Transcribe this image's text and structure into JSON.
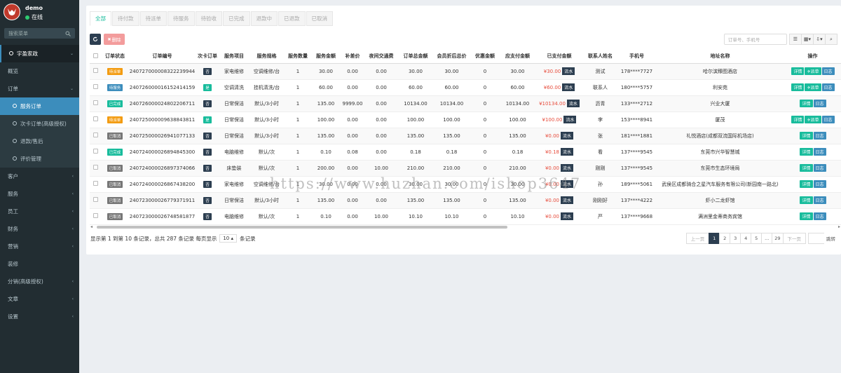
{
  "sidebar": {
    "user": "demo",
    "status": "在线",
    "search_placeholder": "搜索菜单",
    "menu": [
      {
        "label": "宇盈家政",
        "type": "hd"
      },
      {
        "label": "概览",
        "type": "normal"
      },
      {
        "label": "订单",
        "type": "normal",
        "open": true
      },
      {
        "label": "服务订单",
        "type": "act"
      },
      {
        "label": "次卡订单(高级授权)",
        "type": "sub"
      },
      {
        "label": "退款/售后",
        "type": "sub"
      },
      {
        "label": "评价管理",
        "type": "sub"
      },
      {
        "label": "客户",
        "type": "normal"
      },
      {
        "label": "服务",
        "type": "normal"
      },
      {
        "label": "员工",
        "type": "normal"
      },
      {
        "label": "财务",
        "type": "normal"
      },
      {
        "label": "营销",
        "type": "normal"
      },
      {
        "label": "装修",
        "type": "normal",
        "noarrow": true
      },
      {
        "label": "分销(高级授权)",
        "type": "normal"
      },
      {
        "label": "文章",
        "type": "normal"
      },
      {
        "label": "设置",
        "type": "normal"
      }
    ]
  },
  "tabs": [
    "全部",
    "待付款",
    "待派单",
    "待服务",
    "待验收",
    "已完成",
    "退款中",
    "已退款",
    "已取消"
  ],
  "toolbar": {
    "delete_label": "删除",
    "search_placeholder": "订单号、手机号"
  },
  "columns": [
    "订单状态",
    "订单编号",
    "次卡订单",
    "服务项目",
    "服务规格",
    "服务数量",
    "服务金额",
    "补差价",
    "夜间交通费",
    "订单总金额",
    "会员折后总价",
    "优惠金额",
    "应支付金额",
    "已支付金额",
    "联系人姓名",
    "手机号",
    "地址名称",
    "操作"
  ],
  "flow_label": "流水",
  "op_labels": {
    "detail": "详情",
    "dispatch": "派单",
    "log": "日志"
  },
  "rows": [
    {
      "status": "待派单",
      "status_color": "#f39c12",
      "order_no": "240727000008322239944",
      "card": "否",
      "card_color": "#2c3e50",
      "item": "家电维修",
      "spec": "空调维修/台",
      "qty": "1",
      "amount": "30.00",
      "diff": "0.00",
      "night": "0.00",
      "total": "30.00",
      "member": "30.00",
      "discount": "0",
      "payable": "30.00",
      "paid": "¥30.00",
      "contact": "测试",
      "phone": "178****7727",
      "address": "哈尔滨臻图酒店",
      "dispatch": true
    },
    {
      "status": "待服务",
      "status_color": "#3c8dbc",
      "order_no": "240726000016152414159",
      "card": "是",
      "card_color": "#18bc9c",
      "item": "空调清洗",
      "spec": "挂机清洗/台",
      "qty": "1",
      "amount": "60.00",
      "diff": "0.00",
      "night": "0.00",
      "total": "60.00",
      "member": "60.00",
      "discount": "0",
      "payable": "60.00",
      "paid": "¥60.00",
      "contact": "联系人",
      "phone": "180****5757",
      "address": "利安苑",
      "dispatch": true
    },
    {
      "status": "已完成",
      "status_color": "#18bc9c",
      "order_no": "240726000024802206711",
      "card": "否",
      "card_color": "#2c3e50",
      "item": "日常保洁",
      "spec": "默认/3小时",
      "qty": "1",
      "amount": "135.00",
      "diff": "9999.00",
      "night": "0.00",
      "total": "10134.00",
      "member": "10134.00",
      "discount": "0",
      "payable": "10134.00",
      "paid": "¥10134.00",
      "contact": "沥青",
      "phone": "133****2712",
      "address": "兴业大厦",
      "dispatch": false
    },
    {
      "status": "待派单",
      "status_color": "#f39c12",
      "order_no": "240725000009638843811",
      "card": "是",
      "card_color": "#18bc9c",
      "item": "日常保洁",
      "spec": "默认/3小时",
      "qty": "1",
      "amount": "100.00",
      "diff": "0.00",
      "night": "0.00",
      "total": "100.00",
      "member": "100.00",
      "discount": "0",
      "payable": "100.00",
      "paid": "¥100.00",
      "contact": "李",
      "phone": "153****8941",
      "address": "厦茂",
      "dispatch": true
    },
    {
      "status": "已取消",
      "status_color": "#777",
      "order_no": "240725000026941077133",
      "card": "否",
      "card_color": "#2c3e50",
      "item": "日常保洁",
      "spec": "默认/3小时",
      "qty": "1",
      "amount": "135.00",
      "diff": "0.00",
      "night": "0.00",
      "total": "135.00",
      "member": "135.00",
      "discount": "0",
      "payable": "135.00",
      "paid": "¥0.00",
      "contact": "张",
      "phone": "181****1881",
      "address": "礼悦酒店(成都双流国际机场店)",
      "dispatch": false
    },
    {
      "status": "已完成",
      "status_color": "#18bc9c",
      "order_no": "240724000026894845300",
      "card": "否",
      "card_color": "#2c3e50",
      "item": "电脑维修",
      "spec": "默认/次",
      "qty": "1",
      "amount": "0.10",
      "diff": "0.08",
      "night": "0.00",
      "total": "0.18",
      "member": "0.18",
      "discount": "0",
      "payable": "0.18",
      "paid": "¥0.18",
      "contact": "看",
      "phone": "137****9545",
      "address": "东莞市兴华智慧城",
      "dispatch": false
    },
    {
      "status": "已取消",
      "status_color": "#777",
      "order_no": "240724000026897374066",
      "card": "否",
      "card_color": "#2c3e50",
      "item": "床垫装",
      "spec": "默认/次",
      "qty": "1",
      "amount": "200.00",
      "diff": "0.00",
      "night": "10.00",
      "total": "210.00",
      "member": "210.00",
      "discount": "0",
      "payable": "210.00",
      "paid": "¥0.00",
      "contact": "刚刚",
      "phone": "137****9545",
      "address": "东莞市生态环境局",
      "dispatch": false
    },
    {
      "status": "已取消",
      "status_color": "#777",
      "order_no": "240724000026867438200",
      "card": "否",
      "card_color": "#2c3e50",
      "item": "家电维修",
      "spec": "空调维修/台",
      "qty": "1",
      "amount": "30.00",
      "diff": "0.00",
      "night": "0.00",
      "total": "30.00",
      "member": "30.00",
      "discount": "0",
      "payable": "30.00",
      "paid": "¥0.00",
      "contact": "孙",
      "phone": "189****5061",
      "address": "武侯区成都骑合之星汽车服务有限公司(新园南一路北)",
      "dispatch": false
    },
    {
      "status": "已取消",
      "status_color": "#777",
      "order_no": "240723000026779371911",
      "card": "否",
      "card_color": "#2c3e50",
      "item": "日常保洁",
      "spec": "默认/3小时",
      "qty": "1",
      "amount": "135.00",
      "diff": "0.00",
      "night": "0.00",
      "total": "135.00",
      "member": "135.00",
      "discount": "0",
      "payable": "135.00",
      "paid": "¥0.00",
      "contact": "刚刚好",
      "phone": "137****4222",
      "address": "虾小二龙虾馆",
      "dispatch": false
    },
    {
      "status": "已取消",
      "status_color": "#777",
      "order_no": "240723000026748581877",
      "card": "否",
      "card_color": "#2c3e50",
      "item": "电脑维修",
      "spec": "默认/次",
      "qty": "1",
      "amount": "0.10",
      "diff": "0.00",
      "night": "10.00",
      "total": "10.10",
      "member": "10.10",
      "discount": "0",
      "payable": "10.10",
      "paid": "¥0.00",
      "contact": "严",
      "phone": "137****9668",
      "address": "满洲里金蒂商务宾馆",
      "dispatch": false
    }
  ],
  "footer": {
    "info_prefix": "显示第 1 到第 10 条记录，总共 287 条记录 每页显示",
    "per_page": "10",
    "info_suffix": "条记录"
  },
  "pager": [
    "上一页",
    "1",
    "2",
    "3",
    "4",
    "5",
    "...",
    "29",
    "下一页"
  ],
  "jump_label": "跳转",
  "watermark": "https://www.huzhan.com/ishop3647"
}
